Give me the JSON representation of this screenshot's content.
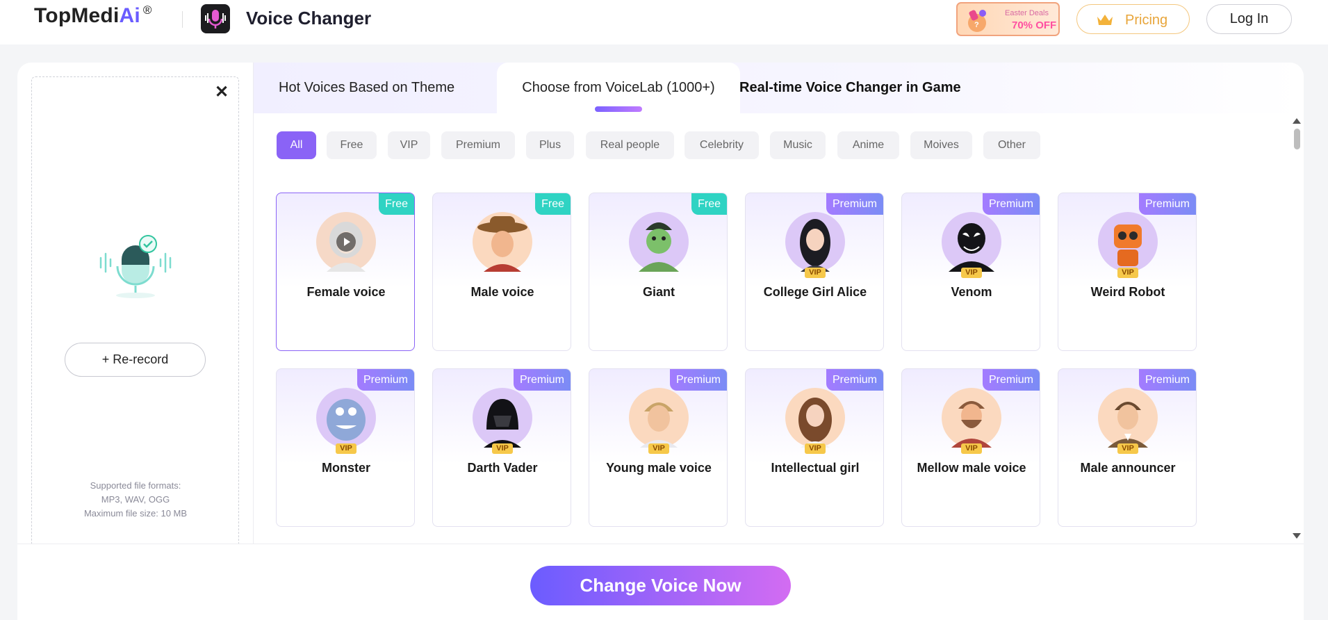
{
  "header": {
    "brand_main": "TopMedi",
    "brand_ai": "Ai",
    "brand_reg": "®",
    "app_title": "Voice Changer",
    "promo_line1": "Easter Deals",
    "promo_line2": "70% OFF",
    "pricing_label": "Pricing",
    "login_label": "Log In"
  },
  "upload": {
    "rerecord_label": "+ Re-record",
    "formats_line1": "Supported file formats:",
    "formats_line2": "MP3, WAV, OGG",
    "formats_line3": "Maximum file size: 10 MB"
  },
  "tabs": {
    "hot": "Hot Voices Based on Theme",
    "voicelab": "Choose from VoiceLab (1000+)",
    "game": "Real-time Voice Changer in Game",
    "active": "voicelab"
  },
  "filters": {
    "active": "All",
    "items": [
      "All",
      "Free",
      "VIP",
      "Premium",
      "Plus",
      "Real people",
      "Celebrity",
      "Music",
      "Anime",
      "Moives",
      "Other"
    ]
  },
  "voices": [
    {
      "name": "Female voice",
      "badge": "Free",
      "vip": "",
      "selected": true,
      "avatar": "female-voice-avatar"
    },
    {
      "name": "Male voice",
      "badge": "Free",
      "vip": "",
      "selected": false,
      "avatar": "cowboy-avatar"
    },
    {
      "name": "Giant",
      "badge": "Free",
      "vip": "",
      "selected": false,
      "avatar": "giant-avatar"
    },
    {
      "name": "College Girl Alice",
      "badge": "Premium",
      "vip": "VIP",
      "selected": false,
      "avatar": "college-girl-avatar"
    },
    {
      "name": "Venom",
      "badge": "Premium",
      "vip": "VIP",
      "selected": false,
      "avatar": "venom-avatar"
    },
    {
      "name": "Weird Robot",
      "badge": "Premium",
      "vip": "VIP",
      "selected": false,
      "avatar": "robot-avatar"
    },
    {
      "name": "Monster",
      "badge": "Premium",
      "vip": "VIP",
      "selected": false,
      "avatar": "monster-avatar"
    },
    {
      "name": "Darth Vader",
      "badge": "Premium",
      "vip": "VIP",
      "selected": false,
      "avatar": "darth-vader-avatar"
    },
    {
      "name": "Young male voice",
      "badge": "Premium",
      "vip": "VIP",
      "selected": false,
      "avatar": "young-male-avatar"
    },
    {
      "name": "Intellectual girl",
      "badge": "Premium",
      "vip": "VIP",
      "selected": false,
      "avatar": "intellectual-girl-avatar"
    },
    {
      "name": "Mellow male voice",
      "badge": "Premium",
      "vip": "VIP",
      "selected": false,
      "avatar": "mellow-male-avatar"
    },
    {
      "name": "Male announcer",
      "badge": "Premium",
      "vip": "VIP",
      "selected": false,
      "avatar": "male-announcer-avatar"
    }
  ],
  "cta_label": "Change Voice Now",
  "colors": {
    "accent": "#8a63f6",
    "free_badge": "#2fd3c3",
    "vip_badge": "#f6c84a",
    "pricing": "#e8a53a"
  }
}
